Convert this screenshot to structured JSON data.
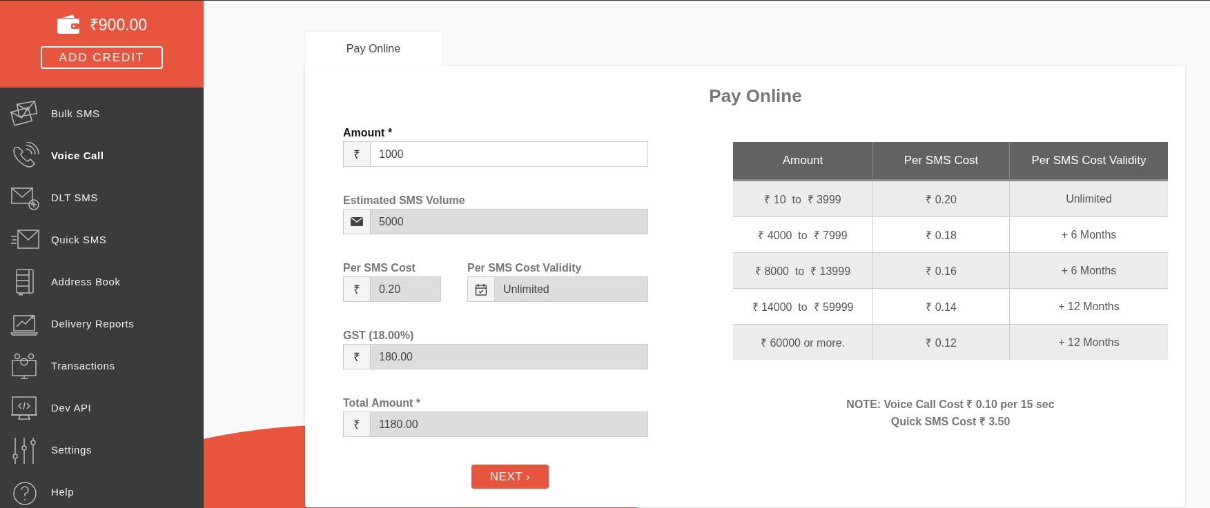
{
  "sidebar": {
    "balance": "₹900.00",
    "add_credit": "ADD CREDIT",
    "items": [
      {
        "label": "Bulk SMS",
        "selected": false
      },
      {
        "label": "Voice Call",
        "selected": true
      },
      {
        "label": "DLT SMS",
        "selected": false
      },
      {
        "label": "Quick SMS",
        "selected": false
      },
      {
        "label": "Address Book",
        "selected": false
      },
      {
        "label": "Delivery Reports",
        "selected": false
      },
      {
        "label": "Transactions",
        "selected": false
      },
      {
        "label": "Dev API",
        "selected": false
      },
      {
        "label": "Settings",
        "selected": false
      },
      {
        "label": "Help",
        "selected": false
      }
    ]
  },
  "tabs": [
    {
      "label": "Pay Online",
      "selected": true
    }
  ],
  "title": "Pay Online",
  "form": {
    "rows": [
      [
        {
          "label": "Amount *",
          "prefix": "₹",
          "value": "1000",
          "readonly": false
        }
      ],
      [
        {
          "label": "Estimated SMS Volume",
          "value": "5000",
          "readonly": true
        }
      ],
      [
        {
          "label": "Per SMS Cost",
          "prefix": "₹",
          "value": "0.20",
          "readonly": true
        },
        {
          "label": "Per SMS Cost Validity",
          "value": "Unlimited",
          "readonly": true
        }
      ],
      [
        {
          "label": "GST (18.00%)",
          "prefix": "₹",
          "value": "180.00",
          "readonly": true
        }
      ],
      [
        {
          "label": "Total Amount *",
          "prefix": "₹",
          "value": "1180.00",
          "readonly": true
        }
      ]
    ],
    "next_button": "NEXT ›"
  },
  "table": {
    "columns": [
      "Amount",
      "Per SMS Cost",
      "Per SMS Cost Validity"
    ],
    "rows": [
      [
        "₹ 10  to  ₹ 3999",
        "₹ 0.20",
        "Unlimited"
      ],
      [
        "₹ 4000  to  ₹ 7999",
        "₹ 0.18",
        "+ 6 Months"
      ],
      [
        "₹ 8000  to  ₹ 13999",
        "₹ 0.16",
        "+ 6 Months"
      ],
      [
        "₹ 14000  to  ₹ 59999",
        "₹ 0.14",
        "+ 12 Months"
      ],
      [
        "₹ 60000 or more.",
        "₹ 0.12",
        "+ 12 Months"
      ]
    ]
  },
  "note": [
    "NOTE: Voice Call Cost ₹ 0.10 per 15 sec",
    "Quick SMS Cost ₹ 3.50"
  ]
}
